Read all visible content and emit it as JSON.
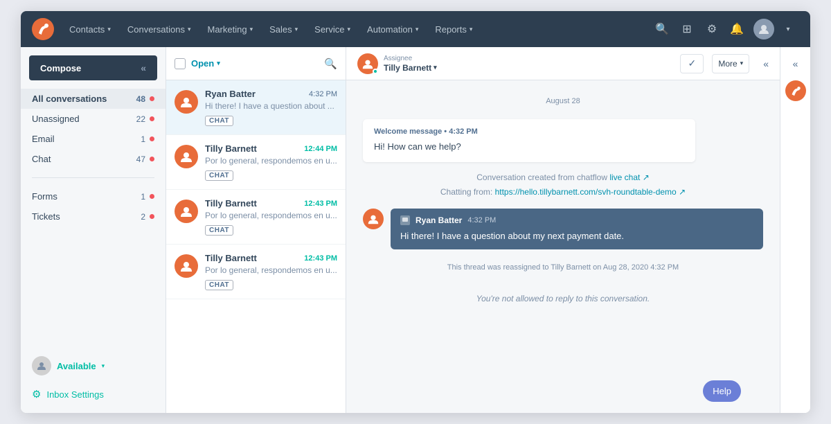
{
  "nav": {
    "items": [
      {
        "label": "Contacts",
        "id": "contacts"
      },
      {
        "label": "Conversations",
        "id": "conversations"
      },
      {
        "label": "Marketing",
        "id": "marketing"
      },
      {
        "label": "Sales",
        "id": "sales"
      },
      {
        "label": "Service",
        "id": "service"
      },
      {
        "label": "Automation",
        "id": "automation"
      },
      {
        "label": "Reports",
        "id": "reports"
      }
    ]
  },
  "sidebar": {
    "compose_label": "Compose",
    "items": [
      {
        "label": "All conversations",
        "count": "48",
        "has_dot": true,
        "active": true
      },
      {
        "label": "Unassigned",
        "count": "22",
        "has_dot": true
      },
      {
        "label": "Email",
        "count": "1",
        "has_dot": true
      },
      {
        "label": "Chat",
        "count": "47",
        "has_dot": true
      }
    ],
    "second_items": [
      {
        "label": "Forms",
        "count": "1",
        "has_dot": true
      },
      {
        "label": "Tickets",
        "count": "2",
        "has_dot": true
      }
    ],
    "available_label": "Available",
    "inbox_settings_label": "Inbox Settings"
  },
  "conv_list": {
    "open_label": "Open",
    "conversations": [
      {
        "name": "Ryan Batter",
        "time": "4:32 PM",
        "preview": "Hi there! I have a question about ...",
        "badge": "CHAT",
        "unread": false,
        "selected": true
      },
      {
        "name": "Tilly Barnett",
        "time": "12:44 PM",
        "preview": "Por lo general, respondemos en u...",
        "badge": "CHAT",
        "unread": true,
        "selected": false
      },
      {
        "name": "Tilly Barnett",
        "time": "12:43 PM",
        "preview": "Por lo general, respondemos en u...",
        "badge": "CHAT",
        "unread": true,
        "selected": false
      },
      {
        "name": "Tilly Barnett",
        "time": "12:43 PM",
        "preview": "Por lo general, respondemos en u...",
        "badge": "CHAT",
        "unread": true,
        "selected": false
      }
    ]
  },
  "chat": {
    "assignee_label": "Assignee",
    "assignee_name": "Tilly Barnett",
    "more_label": "More",
    "date_label": "August 28",
    "welcome_header": "Welcome message • 4:32 PM",
    "welcome_text": "Hi! How can we help?",
    "system_line1": "Conversation created from chatflow",
    "system_link1": "live chat",
    "system_line2": "Chatting from:",
    "system_link2": "https://hello.tillybarnett.com/svh-roundtable-demo",
    "incoming_name": "Ryan Batter",
    "incoming_time": "4:32 PM",
    "incoming_text": "Hi there! I have a question about my next payment date.",
    "thread_reassign": "This thread was reassigned to Tilly Barnett on Aug 28, 2020 4:32 PM",
    "reply_notice": "You're not allowed to reply to this conversation.",
    "help_label": "Help"
  }
}
